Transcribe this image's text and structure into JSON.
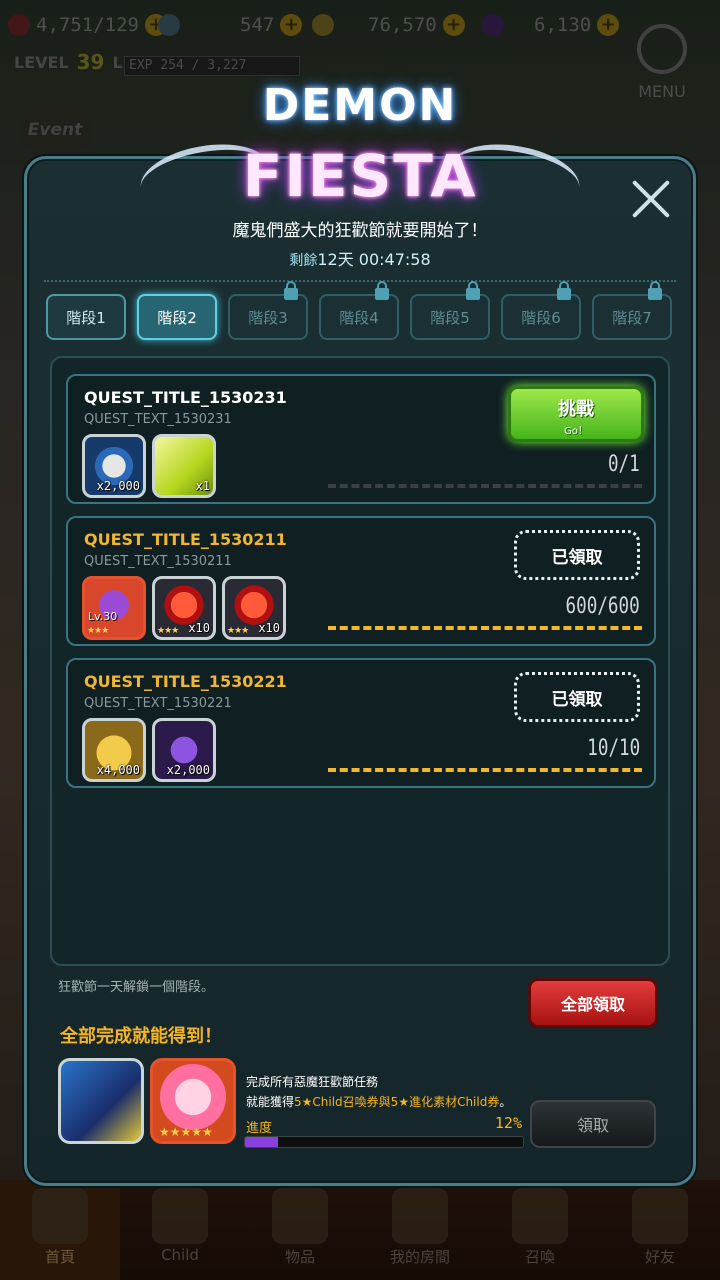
{
  "topbar": {
    "resources": [
      {
        "value": "4,751/129",
        "icon": "heart-icon"
      },
      {
        "value": "547",
        "icon": "crystal-icon"
      },
      {
        "value": "76,570",
        "icon": "gold-coin-icon"
      },
      {
        "value": "6,130",
        "icon": "dark-gem-icon"
      }
    ],
    "level_label": "LEVEL",
    "level": "39",
    "player_name": "Lipa",
    "exp": "EXP 254 / 3,227",
    "menu_label": "MENU",
    "event_label": "Event"
  },
  "event": {
    "logo_line1": "DEMON",
    "logo_line2": "FIESTA",
    "subtitle": "魔鬼們盛大的狂歡節就要開始了！",
    "timer_prefix": "剩餘",
    "timer_value": "12天 00:47:58",
    "tabs": [
      {
        "label": "階段1",
        "state": "open"
      },
      {
        "label": "階段2",
        "state": "selected"
      },
      {
        "label": "階段3",
        "state": "locked"
      },
      {
        "label": "階段4",
        "state": "locked"
      },
      {
        "label": "階段5",
        "state": "locked"
      },
      {
        "label": "階段6",
        "state": "locked"
      },
      {
        "label": "階段7",
        "state": "locked"
      }
    ],
    "quests": [
      {
        "title": "QUEST_TITLE_1530231",
        "text": "QUEST_TEXT_1530231",
        "status": "go",
        "button_main": "挑戰",
        "button_sub": "Go！",
        "progress_text": "0/1",
        "progress": 0,
        "rewards": [
          {
            "icon": "coin-icon",
            "qty": "x2,000"
          },
          {
            "icon": "ticket-icon",
            "qty": "x1"
          }
        ]
      },
      {
        "title": "QUEST_TITLE_1530211",
        "text": "QUEST_TEXT_1530211",
        "status": "claimed",
        "button_main": "已領取",
        "progress_text": "600/600",
        "progress": 1,
        "rewards": [
          {
            "icon": "monster-icon",
            "qty": "",
            "level": "Lv.30",
            "stars": "★★★"
          },
          {
            "icon": "red-gem-icon",
            "qty": "x10",
            "stars": "★★★"
          },
          {
            "icon": "red-gem-icon",
            "qty": "x10",
            "stars": "★★★"
          }
        ]
      },
      {
        "title": "QUEST_TITLE_1530221",
        "text": "QUEST_TEXT_1530221",
        "status": "claimed",
        "button_main": "已領取",
        "progress_text": "10/10",
        "progress": 1,
        "rewards": [
          {
            "icon": "gold-pile-icon",
            "qty": "x4,000"
          },
          {
            "icon": "dark-crystal-icon",
            "qty": "x2,000"
          }
        ]
      }
    ],
    "unlock_note": "狂歡節一天解鎖一個階段。",
    "claim_all_label": "全部領取",
    "complete_title": "全部完成就能得到！",
    "final_reward_line1": "完成所有惡魔狂歡節任務",
    "final_reward_line2_a": "就能獲得",
    "final_reward_line2_b": "5★Child召喚券與5★進化素材Child券",
    "final_reward_line2_c": "。",
    "final_stars": "★★★★★",
    "progress_label": "進度",
    "progress_pct_text": "12%",
    "progress_pct": 0.12,
    "claim_label": "領取"
  },
  "bottom_nav": [
    "首頁",
    "Child",
    "物品",
    "我的房間",
    "召喚",
    "好友"
  ]
}
